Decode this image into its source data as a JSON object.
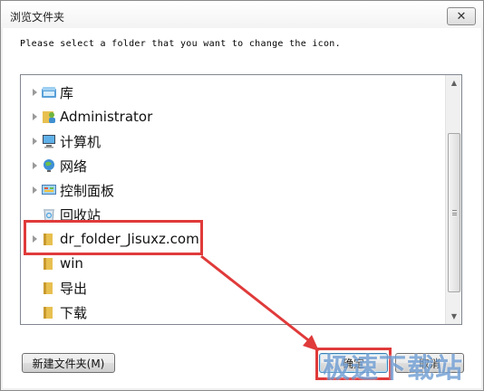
{
  "window": {
    "title": "浏览文件夹",
    "close_glyph": "✕"
  },
  "instruction": "Please select a folder that you want to change the icon.",
  "tree": {
    "items": [
      {
        "label": "库",
        "icon": "library-icon",
        "expandable": true
      },
      {
        "label": "Administrator",
        "icon": "user-folder-icon",
        "expandable": true
      },
      {
        "label": "计算机",
        "icon": "computer-icon",
        "expandable": true
      },
      {
        "label": "网络",
        "icon": "network-icon",
        "expandable": true
      },
      {
        "label": "控制面板",
        "icon": "control-panel-icon",
        "expandable": true
      },
      {
        "label": "回收站",
        "icon": "recycle-bin-icon",
        "expandable": false
      },
      {
        "label": "dr_folder_Jisuxz.com",
        "icon": "folder-icon",
        "expandable": true
      },
      {
        "label": "win",
        "icon": "folder-icon",
        "expandable": false
      },
      {
        "label": "导出",
        "icon": "folder-icon",
        "expandable": false
      },
      {
        "label": "下载",
        "icon": "folder-icon",
        "expandable": false
      }
    ]
  },
  "scrollbar": {
    "up_glyph": "▲",
    "down_glyph": "▼"
  },
  "buttons": {
    "new_folder": "新建文件夹(M)",
    "ok": "确定",
    "cancel": "取消"
  },
  "watermark": "极速下载站",
  "colors": {
    "annotation_red": "#e03a3a",
    "folder_yellow": "#e8c050",
    "watermark_blue": "#2b6fbf"
  }
}
